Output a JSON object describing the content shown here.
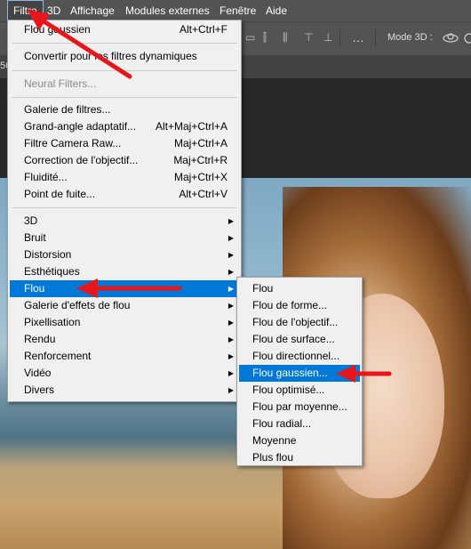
{
  "menubar": {
    "items": [
      "Filtre",
      "3D",
      "Affichage",
      "Modules externes",
      "Fenêtre",
      "Aide"
    ]
  },
  "optionsbar": {
    "mode3d_label": "Mode 3D :",
    "more_icon": "…"
  },
  "tab_partial": "56",
  "filter_menu": {
    "last_filter": {
      "label": "Flou gaussien",
      "shortcut": "Alt+Ctrl+F"
    },
    "convert_smart": "Convertir pour les filtres dynamiques",
    "neural": "Neural Filters...",
    "group_filters": [
      {
        "label": "Galerie de filtres...",
        "shortcut": ""
      },
      {
        "label": "Grand-angle adaptatif...",
        "shortcut": "Alt+Maj+Ctrl+A"
      },
      {
        "label": "Filtre Camera Raw...",
        "shortcut": "Maj+Ctrl+A"
      },
      {
        "label": "Correction de l'objectif...",
        "shortcut": "Maj+Ctrl+R"
      },
      {
        "label": "Fluidité...",
        "shortcut": "Maj+Ctrl+X"
      },
      {
        "label": "Point de fuite...",
        "shortcut": "Alt+Ctrl+V"
      }
    ],
    "categories": [
      "3D",
      "Bruit",
      "Distorsion",
      "Esthétiques",
      "Flou",
      "Galerie d'effets de flou",
      "Pixellisation",
      "Rendu",
      "Renforcement",
      "Vidéo",
      "Divers"
    ],
    "highlighted": "Flou"
  },
  "blur_submenu": {
    "items": [
      "Flou",
      "Flou de forme...",
      "Flou de l'objectif...",
      "Flou de surface...",
      "Flou directionnel...",
      "Flou gaussien...",
      "Flou optimisé...",
      "Flou par moyenne...",
      "Flou radial...",
      "Moyenne",
      "Plus flou"
    ],
    "highlighted": "Flou gaussien..."
  },
  "colors": {
    "highlight": "#0078d7",
    "arrow": "#e8161b",
    "menu_bg": "#f0f0f0",
    "menubar_bg": "#535353"
  }
}
